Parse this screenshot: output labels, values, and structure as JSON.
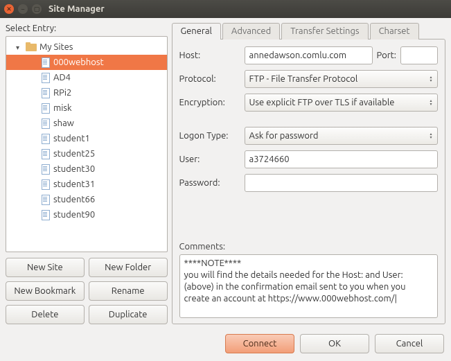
{
  "window": {
    "title": "Site Manager"
  },
  "left": {
    "label": "Select Entry:",
    "root": "My Sites",
    "sites": [
      "000webhost",
      "AD4",
      "RPi2",
      "misk",
      "shaw",
      "student1",
      "student25",
      "student30",
      "student31",
      "student66",
      "student90"
    ],
    "selected_index": 0,
    "buttons": {
      "new_site": "New Site",
      "new_folder": "New Folder",
      "new_bookmark": "New Bookmark",
      "rename": "Rename",
      "delete": "Delete",
      "duplicate": "Duplicate"
    }
  },
  "tabs": {
    "general": "General",
    "advanced": "Advanced",
    "transfer": "Transfer Settings",
    "charset": "Charset",
    "active": "general"
  },
  "form": {
    "host_label": "Host:",
    "host_value": "annedawson.comlu.com",
    "port_label": "Port:",
    "port_value": "",
    "protocol_label": "Protocol:",
    "protocol_value": "FTP - File Transfer Protocol",
    "encryption_label": "Encryption:",
    "encryption_value": "Use explicit FTP over TLS if available",
    "logon_label": "Logon Type:",
    "logon_value": "Ask for password",
    "user_label": "User:",
    "user_value": "a3724660",
    "password_label": "Password:",
    "password_value": "",
    "comments_label": "Comments:",
    "comments_value": "****NOTE****\nyou will find the details needed for the Host: and User: (above) in the confirmation email sent to you when you create an account at https://www.000webhost.com/"
  },
  "footer": {
    "connect": "Connect",
    "ok": "OK",
    "cancel": "Cancel"
  }
}
